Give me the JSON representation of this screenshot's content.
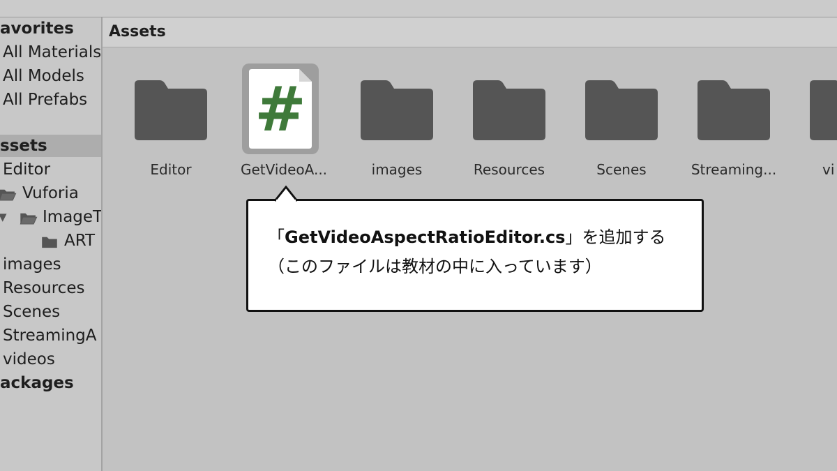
{
  "sidebar": {
    "favorites_header": "avorites",
    "favorites": [
      "All Materials",
      "All Models",
      "All Prefabs"
    ],
    "assets_header": "ssets",
    "tree": [
      {
        "label": "Editor"
      },
      {
        "label": "Vuforia"
      },
      {
        "label": "ImageT"
      },
      {
        "label": "ART"
      },
      {
        "label": "images"
      },
      {
        "label": "Resources"
      },
      {
        "label": "Scenes"
      },
      {
        "label": "StreamingA"
      },
      {
        "label": "videos"
      }
    ],
    "packages_header": "ackages"
  },
  "main": {
    "title": "Assets",
    "items": [
      {
        "label": "Editor",
        "icon": "folder-icon"
      },
      {
        "label": "GetVideoA...",
        "icon": "csharp-script-icon",
        "symbol": "#"
      },
      {
        "label": "images",
        "icon": "folder-icon"
      },
      {
        "label": "Resources",
        "icon": "folder-icon"
      },
      {
        "label": "Scenes",
        "icon": "folder-icon"
      },
      {
        "label": "Streaming...",
        "icon": "folder-icon"
      },
      {
        "label": "vi",
        "icon": "folder-icon"
      }
    ]
  },
  "callout": {
    "open_bracket": "「",
    "filename": "GetVideoAspectRatioEditor.cs",
    "close_text": "」を追加する",
    "line2": "（このファイルは教材の中に入っています）"
  },
  "colors": {
    "folder": "#555555",
    "script_symbol": "#3f7a3a",
    "background": "#c2c2c2",
    "selected_row": "#adadad"
  }
}
